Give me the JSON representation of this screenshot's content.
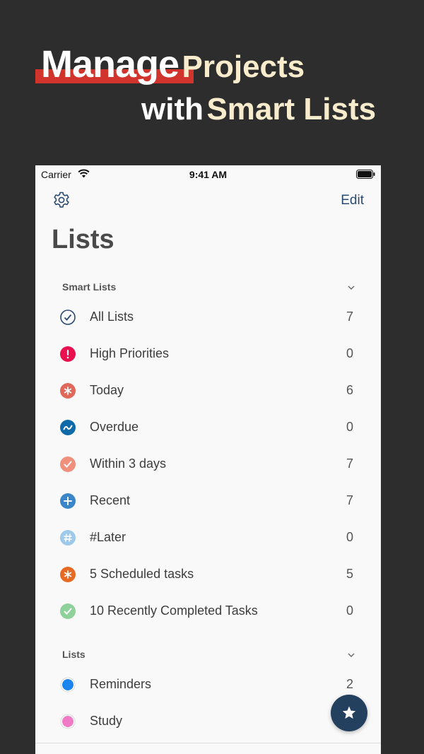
{
  "headline": {
    "word1": "Manage",
    "word2": "Projects",
    "word3": "with",
    "word4": "Smart Lists",
    "accent_color": "#d0342c",
    "highlight_color": "#f8eccd"
  },
  "status_bar": {
    "carrier": "Carrier",
    "time": "9:41 AM"
  },
  "nav": {
    "settings_icon": "gear-icon",
    "edit_label": "Edit"
  },
  "page_title": "Lists",
  "smart_lists": {
    "header": "Smart Lists",
    "items": [
      {
        "label": "All Lists",
        "count": "7",
        "icon": "check-circle-icon",
        "color": "#2b4a70"
      },
      {
        "label": "High Priorities",
        "count": "0",
        "icon": "exclamation-icon",
        "color": "#e8104e"
      },
      {
        "label": "Today",
        "count": "6",
        "icon": "asterisk-icon",
        "color": "#e0685a"
      },
      {
        "label": "Overdue",
        "count": "0",
        "icon": "wave-icon",
        "color": "#0d6aa8"
      },
      {
        "label": "Within 3 days",
        "count": "7",
        "icon": "check-icon",
        "color": "#f0907c"
      },
      {
        "label": "Recent",
        "count": "7",
        "icon": "plus-icon",
        "color": "#3a86c8"
      },
      {
        "label": "#Later",
        "count": "0",
        "icon": "hash-icon",
        "color": "#9fc9e8"
      },
      {
        "label": "5 Scheduled tasks",
        "count": "5",
        "icon": "asterisk-icon",
        "color": "#e66a24"
      },
      {
        "label": "10 Recently Completed Tasks",
        "count": "0",
        "icon": "check-icon",
        "color": "#8fd19a"
      }
    ]
  },
  "lists": {
    "header": "Lists",
    "items": [
      {
        "label": "Reminders",
        "count": "2",
        "icon": "dot-circle-icon",
        "color": "#1a84f0"
      },
      {
        "label": "Study",
        "count": "",
        "icon": "dot-circle-icon",
        "color": "#f07ac6"
      }
    ]
  },
  "fab": {
    "icon": "star-icon",
    "color": "#24405f"
  }
}
